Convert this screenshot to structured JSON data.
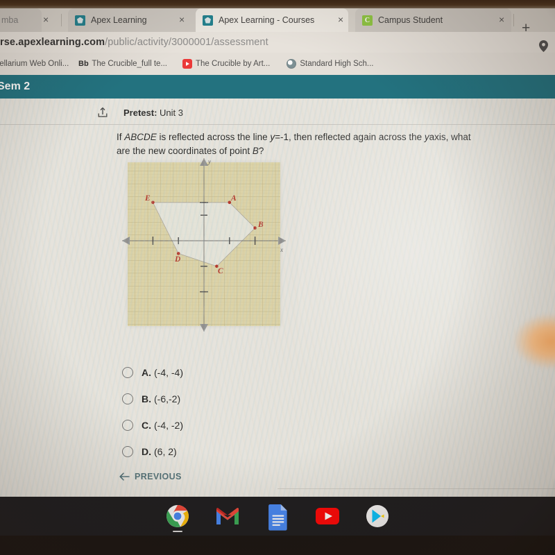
{
  "browser": {
    "tabs": [
      {
        "title": "mba",
        "favicon": "none",
        "active": false,
        "truncated": true
      },
      {
        "title": "Apex Learning",
        "favicon": "apex-icon",
        "active": false
      },
      {
        "title": "Apex Learning - Courses",
        "favicon": "apex-icon",
        "active": true
      },
      {
        "title": "Campus Student",
        "favicon": "campus-icon",
        "active": false
      }
    ],
    "new_tab_label": "+",
    "close_label": "×",
    "url": {
      "prefix": "rse.apexlearning.com",
      "path": "/public/activity/3000001/assessment",
      "full": "rse.apexlearning.com/public/activity/3000001/assessment"
    },
    "location_icon": "location-pin-icon",
    "bookmarks": [
      {
        "label": "tellarium Web Onli...",
        "icon": "none"
      },
      {
        "label": "The Crucible_full te...",
        "icon": "blackboard-icon",
        "icon_text": "Bb"
      },
      {
        "label": "The Crucible by Art...",
        "icon": "youtube-icon"
      },
      {
        "label": "Standard High Sch...",
        "icon": "globe-icon"
      }
    ]
  },
  "app": {
    "header": {
      "title": "Sem 2",
      "background": "#1b6f7e"
    },
    "breadcrumb": {
      "icon": "share-arrow-icon",
      "bold_label": "Pretest:",
      "label": "Unit 3"
    },
    "question": {
      "line1_a": "If ",
      "italic1": "ABCDE",
      "line1_b": " is reflected across the line ",
      "italic2": "y",
      "line1_c": "=-1, then reflected again across the ",
      "italic3": "y",
      "line2_a": "axis, what are the new coordinates of point ",
      "italic4": "B",
      "line2_b": "?"
    },
    "answers": [
      {
        "letter": "A.",
        "value": "(-4, -4)",
        "selected": false
      },
      {
        "letter": "B.",
        "value": "(-6,-2)",
        "selected": false
      },
      {
        "letter": "C.",
        "value": "(-4, -2)",
        "selected": false
      },
      {
        "letter": "D.",
        "value": "(6, 2)",
        "selected": false
      }
    ],
    "previous_button": {
      "label": "PREVIOUS",
      "icon": "arrow-left-icon"
    }
  },
  "chart_data": {
    "type": "scatter",
    "title": "",
    "xlabel": "x",
    "ylabel": "y",
    "xlim": [
      -6,
      6
    ],
    "ylim": [
      -7,
      5
    ],
    "grid": true,
    "point_color": "#b4342a",
    "plot_bg": "#ded5a8",
    "polygon_fill": "#e4e6e0",
    "points": [
      {
        "label": "A",
        "x": 2,
        "y": 3
      },
      {
        "label": "B",
        "x": 4,
        "y": 1
      },
      {
        "label": "C",
        "x": 1,
        "y": -2
      },
      {
        "label": "D",
        "x": -2,
        "y": -1
      },
      {
        "label": "E",
        "x": -4,
        "y": 3
      }
    ],
    "polygon_order": [
      "A",
      "B",
      "C",
      "D",
      "E"
    ],
    "x_ticks": [
      -4,
      -2,
      2,
      4
    ],
    "y_ticks": [
      -4,
      -2,
      2,
      3
    ]
  },
  "shelf": {
    "icons": [
      {
        "name": "chrome-icon",
        "active": true
      },
      {
        "name": "gmail-icon",
        "active": false
      },
      {
        "name": "google-docs-icon",
        "active": false
      },
      {
        "name": "youtube-icon",
        "active": false
      },
      {
        "name": "play-store-icon",
        "active": false
      }
    ]
  }
}
